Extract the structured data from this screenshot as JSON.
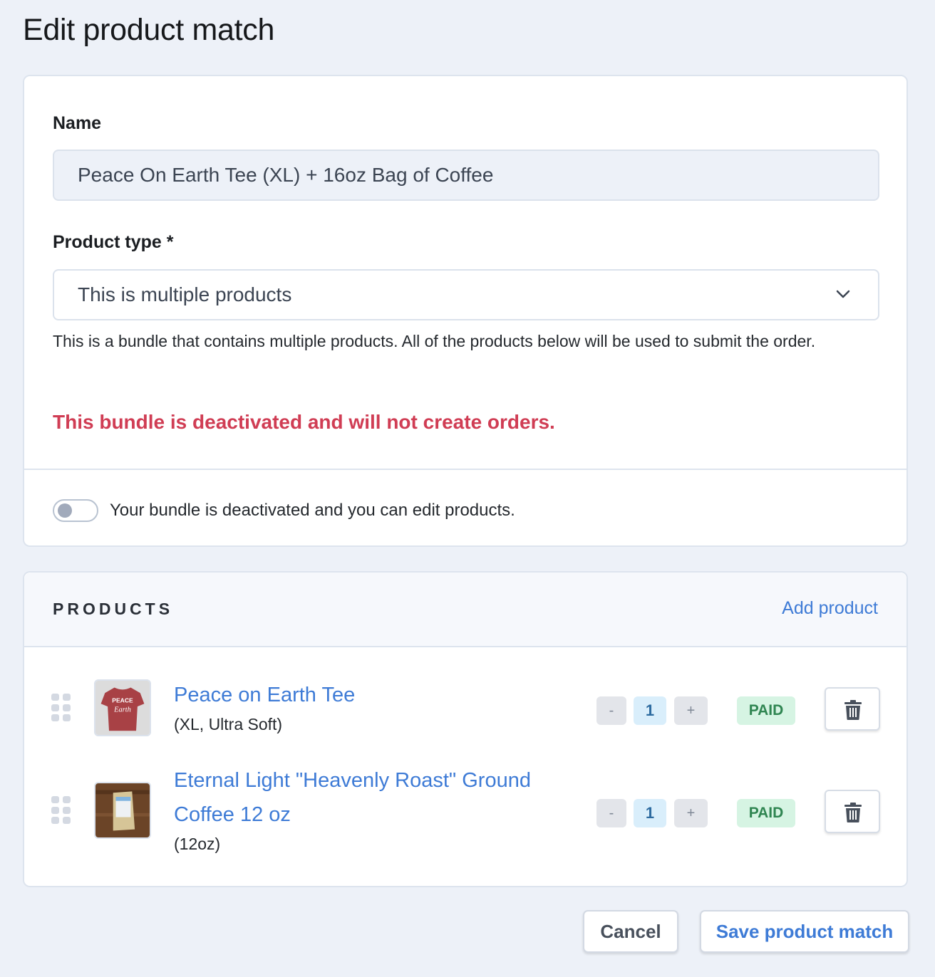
{
  "page": {
    "title": "Edit product match"
  },
  "form": {
    "name_label": "Name",
    "name_value": "Peace On Earth Tee (XL) + 16oz Bag of Coffee",
    "product_type_label": "Product type *",
    "product_type_selected": "This is multiple products",
    "product_type_help": "This is a bundle that contains multiple products. All of the products below will be used to submit the order.",
    "warning": "This bundle is deactivated and will not create orders.",
    "toggle": {
      "state": "off",
      "label": "Your bundle is deactivated and you can edit products."
    }
  },
  "products": {
    "section_title": "PRODUCTS",
    "add_label": "Add product",
    "items": [
      {
        "name": "Peace on Earth Tee",
        "variant": "(XL, Ultra Soft)",
        "thumb": "red-tshirt-image",
        "qty_minus": "-",
        "quantity": "1",
        "qty_plus": "+",
        "status": "PAID"
      },
      {
        "name_line1": "Eternal Light \"Heavenly Roast\" Ground",
        "name_line2": "Coffee 12 oz",
        "variant": "(12oz)",
        "thumb": "coffee-bag-image",
        "qty_minus": "-",
        "quantity": "1",
        "qty_plus": "+",
        "status": "PAID"
      }
    ]
  },
  "actions": {
    "cancel_label": "Cancel",
    "save_label": "Save product match"
  },
  "colors": {
    "accent": "#3e7bd6",
    "danger": "#d03d54",
    "success_bg": "#d6f4e3",
    "success_text": "#2f8551",
    "background": "#edf1f8"
  }
}
